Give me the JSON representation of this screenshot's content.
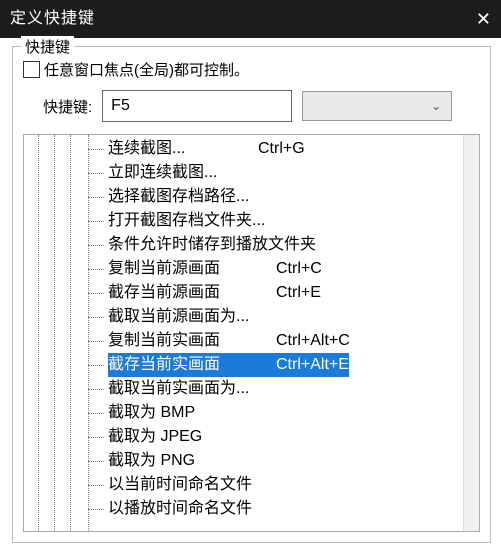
{
  "titlebar": {
    "title": "定义快捷键",
    "close": "✕"
  },
  "fieldset": {
    "legend": "快捷键",
    "checkbox_label": "任意窗口焦点(全局)都可控制。",
    "input_label": "快捷键:",
    "input_value": "F5"
  },
  "tree": {
    "items": [
      {
        "label": "连续截图...",
        "shortcut": "Ctrl+G",
        "selected": false,
        "tight": true
      },
      {
        "label": "立即连续截图...",
        "shortcut": "",
        "selected": false
      },
      {
        "label": "选择截图存档路径...",
        "shortcut": "",
        "selected": false
      },
      {
        "label": "打开截图存档文件夹...",
        "shortcut": "",
        "selected": false
      },
      {
        "label": "条件允许时储存到播放文件夹",
        "shortcut": "",
        "selected": false
      },
      {
        "label": "复制当前源画面",
        "shortcut": "Ctrl+C",
        "selected": false
      },
      {
        "label": "截存当前源画面",
        "shortcut": "Ctrl+E",
        "selected": false
      },
      {
        "label": "截取当前源画面为...",
        "shortcut": "",
        "selected": false
      },
      {
        "label": "复制当前实画面",
        "shortcut": "Ctrl+Alt+C",
        "selected": false
      },
      {
        "label": "截存当前实画面",
        "shortcut": "Ctrl+Alt+E",
        "selected": true
      },
      {
        "label": "截取当前实画面为...",
        "shortcut": "",
        "selected": false
      },
      {
        "label": "截取为 BMP",
        "shortcut": "",
        "selected": false
      },
      {
        "label": "截取为 JPEG",
        "shortcut": "",
        "selected": false
      },
      {
        "label": "截取为 PNG",
        "shortcut": "",
        "selected": false
      },
      {
        "label": "以当前时间命名文件",
        "shortcut": "",
        "selected": false
      },
      {
        "label": "以播放时间命名文件",
        "shortcut": "",
        "selected": false
      }
    ]
  }
}
